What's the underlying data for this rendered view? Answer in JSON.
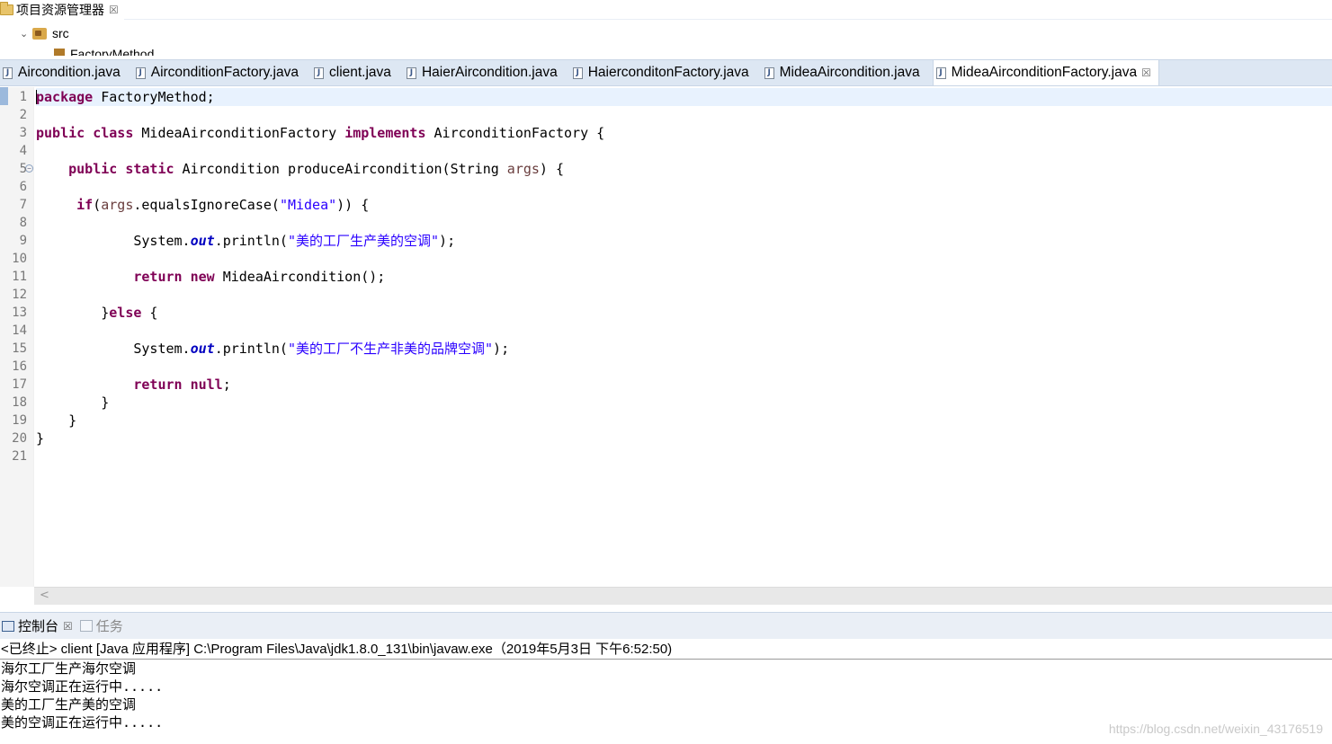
{
  "explorer": {
    "tab_label": "项目资源管理器",
    "close_glyph": "☒",
    "src_label": "src",
    "package_label": "FactoryMethod"
  },
  "editor_tabs": [
    {
      "label": "Aircondition.java",
      "active": false
    },
    {
      "label": "AirconditionFactory.java",
      "active": false
    },
    {
      "label": "client.java",
      "active": false
    },
    {
      "label": "HaierAircondition.java",
      "active": false
    },
    {
      "label": "HaierconditonFactory.java",
      "active": false
    },
    {
      "label": "MideaAircondition.java",
      "active": false
    },
    {
      "label": "MideaAirconditionFactory.java",
      "active": true
    }
  ],
  "code": {
    "line_numbers": [
      "1",
      "2",
      "3",
      "4",
      "5",
      "6",
      "7",
      "8",
      "9",
      "10",
      "11",
      "12",
      "13",
      "14",
      "15",
      "16",
      "17",
      "18",
      "19",
      "20",
      "21"
    ],
    "lines": [
      [
        {
          "t": "package",
          "c": "kw"
        },
        {
          "t": " FactoryMethod;",
          "c": ""
        }
      ],
      [],
      [
        {
          "t": "public",
          "c": "kw"
        },
        {
          "t": " ",
          "c": ""
        },
        {
          "t": "class",
          "c": "kw"
        },
        {
          "t": " MideaAirconditionFactory ",
          "c": ""
        },
        {
          "t": "implements",
          "c": "kw"
        },
        {
          "t": " AirconditionFactory {",
          "c": ""
        }
      ],
      [],
      [
        {
          "t": "    ",
          "c": ""
        },
        {
          "t": "public",
          "c": "kw"
        },
        {
          "t": " ",
          "c": ""
        },
        {
          "t": "static",
          "c": "kw"
        },
        {
          "t": " Aircondition produceAircondition(String ",
          "c": ""
        },
        {
          "t": "args",
          "c": "var"
        },
        {
          "t": ") {",
          "c": ""
        }
      ],
      [],
      [
        {
          "t": "     ",
          "c": ""
        },
        {
          "t": "if",
          "c": "kw"
        },
        {
          "t": "(",
          "c": ""
        },
        {
          "t": "args",
          "c": "var"
        },
        {
          "t": ".equalsIgnoreCase(",
          "c": ""
        },
        {
          "t": "\"Midea\"",
          "c": "str"
        },
        {
          "t": ")) {",
          "c": ""
        }
      ],
      [],
      [
        {
          "t": "            System.",
          "c": ""
        },
        {
          "t": "out",
          "c": "fld"
        },
        {
          "t": ".println(",
          "c": ""
        },
        {
          "t": "\"美的工厂生产美的空调\"",
          "c": "str"
        },
        {
          "t": ");",
          "c": ""
        }
      ],
      [],
      [
        {
          "t": "            ",
          "c": ""
        },
        {
          "t": "return",
          "c": "kw"
        },
        {
          "t": " ",
          "c": ""
        },
        {
          "t": "new",
          "c": "kw"
        },
        {
          "t": " MideaAircondition();",
          "c": ""
        }
      ],
      [],
      [
        {
          "t": "        }",
          "c": ""
        },
        {
          "t": "else",
          "c": "kw"
        },
        {
          "t": " {",
          "c": ""
        }
      ],
      [],
      [
        {
          "t": "            System.",
          "c": ""
        },
        {
          "t": "out",
          "c": "fld"
        },
        {
          "t": ".println(",
          "c": ""
        },
        {
          "t": "\"美的工厂不生产非美的品牌空调\"",
          "c": "str"
        },
        {
          "t": ");",
          "c": ""
        }
      ],
      [],
      [
        {
          "t": "            ",
          "c": ""
        },
        {
          "t": "return",
          "c": "kw"
        },
        {
          "t": " ",
          "c": ""
        },
        {
          "t": "null",
          "c": "kw"
        },
        {
          "t": ";",
          "c": ""
        }
      ],
      [
        {
          "t": "        }",
          "c": ""
        }
      ],
      [
        {
          "t": "    }",
          "c": ""
        }
      ],
      [
        {
          "t": "}",
          "c": ""
        }
      ],
      []
    ]
  },
  "console": {
    "tab_console": "控制台",
    "tab_tasks": "任务",
    "header": "<已终止> client [Java 应用程序] C:\\Program Files\\Java\\jdk1.8.0_131\\bin\\javaw.exe（2019年5月3日 下午6:52:50)",
    "output": [
      "海尔工厂生产海尔空调",
      "海尔空调正在运行中.....",
      "美的工厂生产美的空调",
      "美的空调正在运行中....."
    ]
  },
  "watermark": "https://blog.csdn.net/weixin_43176519",
  "colors": {
    "keyword": "#7f0055",
    "string": "#2a00ff",
    "field": "#0000c0",
    "tab_bar": "#dde7f3"
  }
}
